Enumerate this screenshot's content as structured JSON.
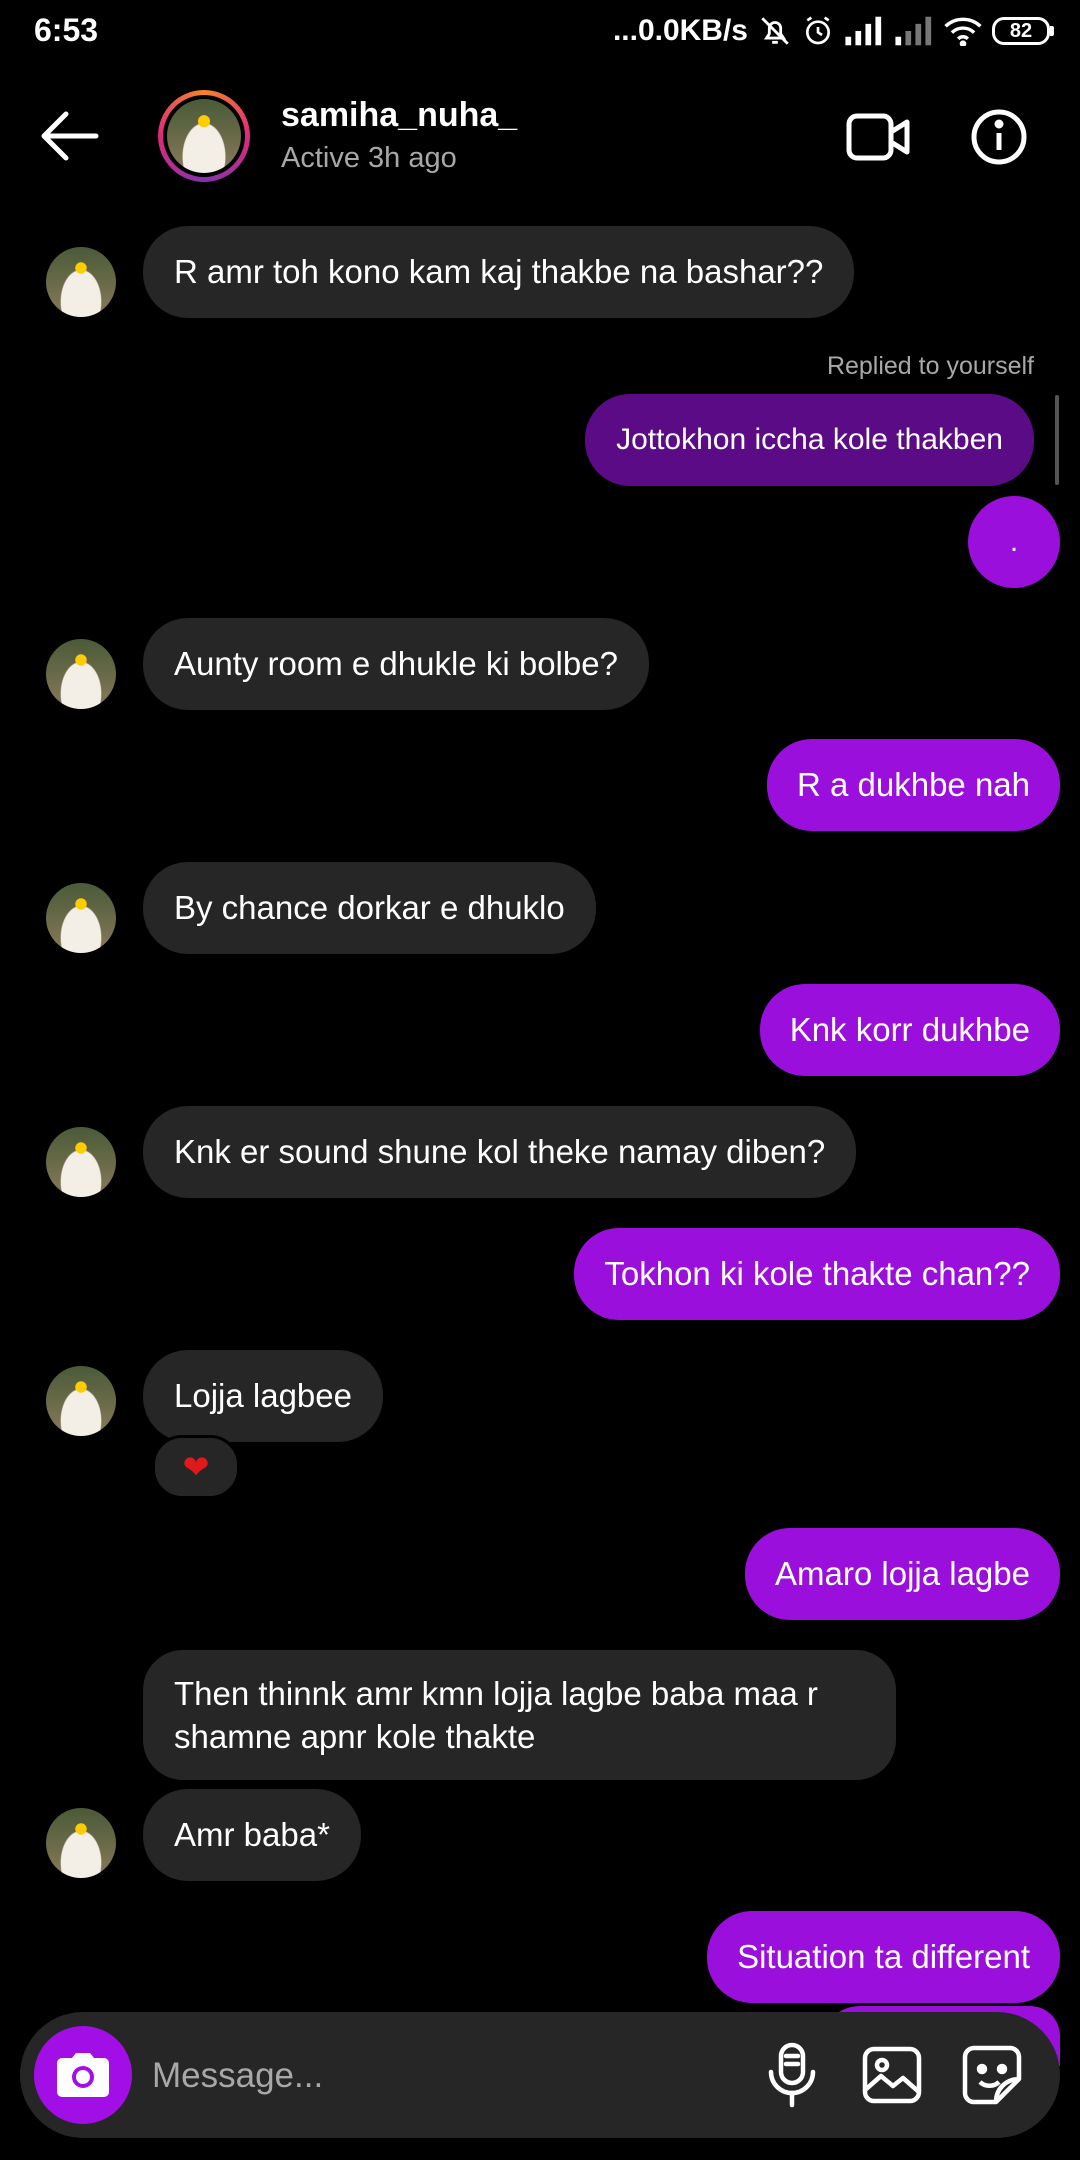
{
  "status_bar": {
    "time": "6:53",
    "network_speed": "...0.0KB/s",
    "battery": "82",
    "icons": [
      "mute-icon",
      "alarm-icon",
      "signal-icon",
      "signal-icon",
      "wifi-icon",
      "battery-icon"
    ]
  },
  "header": {
    "username": "samiha_nuha_",
    "status": "Active 3h ago",
    "icons": [
      "back-arrow-icon",
      "video-call-icon",
      "info-icon"
    ]
  },
  "messages": [
    {
      "from": "them",
      "text": "R amr toh kono kam kaj thakbe na bashar??"
    },
    {
      "from": "me",
      "reply_label": "Replied to yourself",
      "text": "Jottokhon iccha kole thakben"
    },
    {
      "from": "me",
      "text": "."
    },
    {
      "from": "them",
      "text": "Aunty room e dhukle ki bolbe?"
    },
    {
      "from": "me",
      "text": "R a dukhbe nah"
    },
    {
      "from": "them",
      "text": "By chance dorkar e dhuklo"
    },
    {
      "from": "me",
      "text": "Knk korr dukhbe"
    },
    {
      "from": "them",
      "text": "Knk er sound shune kol theke namay diben?"
    },
    {
      "from": "me",
      "text": "Tokhon ki kole thakte chan??"
    },
    {
      "from": "them",
      "text": "Lojja lagbee",
      "reaction": "❤"
    },
    {
      "from": "me",
      "text": "Amaro lojja lagbe"
    },
    {
      "from": "them",
      "text": "Then thinnk amr kmn lojja lagbe baba maa r shamne apnr kole thakte"
    },
    {
      "from": "them",
      "text": "Amr baba*"
    },
    {
      "from": "me",
      "text": "Situation ta different"
    }
  ],
  "composer": {
    "placeholder": "Message...",
    "icons": [
      "camera-icon",
      "microphone-icon",
      "gallery-icon",
      "sticker-icon"
    ]
  },
  "colors": {
    "background": "#000000",
    "sent_bubble": "#9b0fdc",
    "reply_bubble": "#5b0b85",
    "received_bubble": "#262626",
    "muted_text": "#a8a8a8"
  }
}
